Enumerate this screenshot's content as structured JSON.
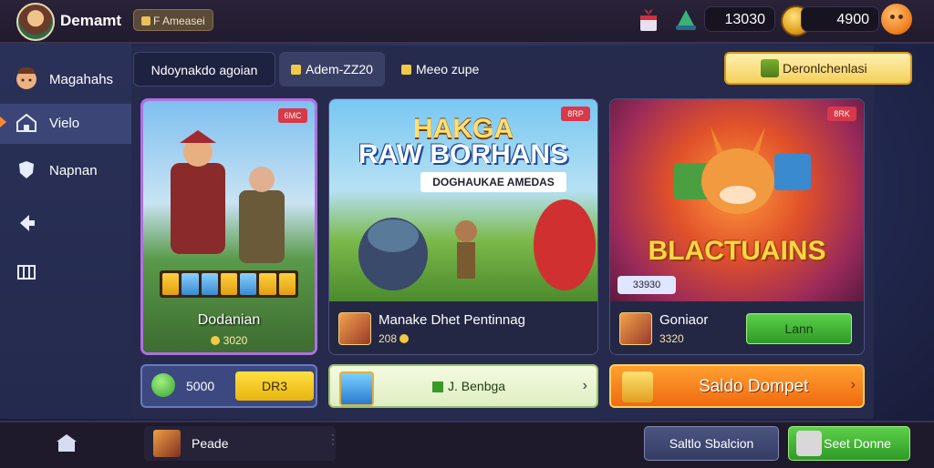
{
  "header": {
    "username": "Demamt",
    "tag": "F Ameasei",
    "currency1": "13030",
    "currency2": "4900"
  },
  "sidebar": {
    "items": [
      {
        "label": "Magahahs",
        "icon": "face-icon"
      },
      {
        "label": "Vielo",
        "icon": "house-icon",
        "active": true
      },
      {
        "label": "Napnan",
        "icon": "shield-icon"
      },
      {
        "label": "",
        "icon": "arrow-left-icon"
      },
      {
        "label": "",
        "icon": "grid-icon"
      }
    ]
  },
  "tabs": [
    {
      "label": "Ndoynakdo agoian"
    },
    {
      "label": "Adem-ZZ20",
      "icon": "gold-icon"
    },
    {
      "label": "Meeo zupe",
      "icon": "gold-icon"
    }
  ],
  "wallet_button": {
    "label": "Deronlchenlasi"
  },
  "cards": [
    {
      "badge": "6MC",
      "name": "Dodanian",
      "price": "3020"
    },
    {
      "badge": "8RP",
      "title_line1": "HAKGA",
      "title_line2": "RAW BORHANS",
      "subtitle": "DOGHAUKAE AMEDAS",
      "name": "Manake Dhet Pentinnag",
      "price": "208"
    },
    {
      "badge": "8RK",
      "title": "BLACTUAINS",
      "price_tag": "33930",
      "name": "Goniaor",
      "price": "3320",
      "button": "Lann"
    }
  ],
  "actions": {
    "gem_value": "5000",
    "gem_button": "DR3",
    "bundle_label": "J. Benbga",
    "balance_button": "Saldo Dompet"
  },
  "bottom": {
    "player_name": "Peade",
    "btn1": "Saltlo Sbalcion",
    "btn2": "Seet Donne"
  }
}
